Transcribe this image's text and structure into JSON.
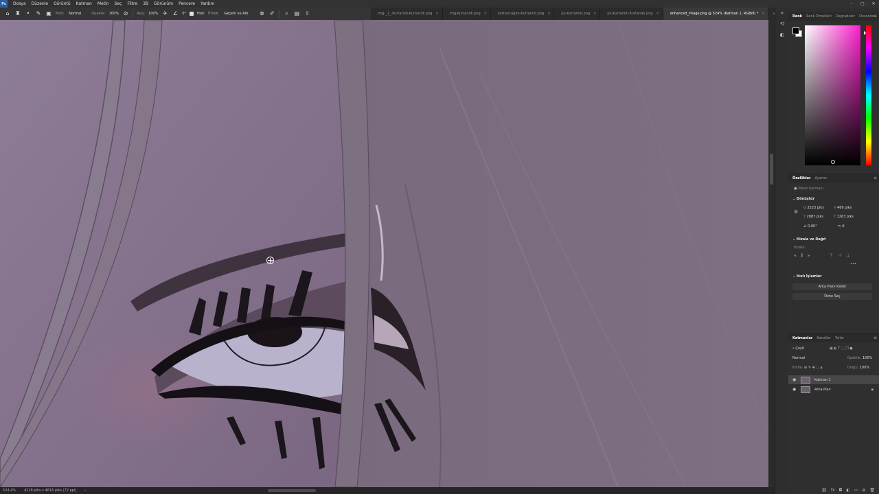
{
  "menubar": {
    "logo": "Ps",
    "items": [
      "Dosya",
      "Düzenle",
      "Görüntü",
      "Katman",
      "Metin",
      "Seç",
      "Filtre",
      "3B",
      "Görünüm",
      "Pencere",
      "Yardım"
    ],
    "window_controls": [
      "–",
      "▢",
      "✕"
    ]
  },
  "options": {
    "mode_label": "Mod:",
    "mode_value": "Normal",
    "opacity_label": "Opaklık:",
    "opacity_value": "100%",
    "flow_label": "Akış:",
    "flow_value": "100%",
    "angle_value": "0°",
    "hizli_label": "Hızlı",
    "sample_label": "Örnek:",
    "sample_value": "Geçerli ve Altı"
  },
  "tabs": [
    {
      "label": "img-_1_-Kurtarıldı-Kurtarıldı.png",
      "active": false
    },
    {
      "label": "img-Kurtarıldı.png",
      "active": false
    },
    {
      "label": "kurtarıcağım-Kurtarıldı.png",
      "active": false
    },
    {
      "label": "px-Kurtarıldı.png",
      "active": false
    },
    {
      "label": "px-Kurtarıldı-Kurtarıldı.png",
      "active": false
    },
    {
      "label": "enhanced_image.png @ 524% (Katman 1, RGB/8) *",
      "active": true
    }
  ],
  "tab_close": "×",
  "tab_overflow": "»",
  "status": {
    "zoom": "524,4%",
    "doc_size": "4128 piks x 4616 piks (72 ppi)",
    "arrow": "›"
  },
  "color_panel": {
    "tabs": [
      "Renk",
      "Renk Örnekleri",
      "Degradeler",
      "Desenler"
    ],
    "active_tab": "Renk",
    "foreground": "#000000",
    "background": "#ffffff",
    "hue_color": "#ff1fcf"
  },
  "properties": {
    "tabs": [
      "Özellikler",
      "Ayarlar"
    ],
    "layer_type": "Piksel Katmanı",
    "transform_title": "Dönüştür",
    "w_label": "G",
    "w_value": "2223 piks",
    "x_label": "X",
    "x_value": "469 piks",
    "h_label": "Y",
    "h_value": "2887 piks",
    "y_label": "Y",
    "y_value": "1263 piks",
    "angle_value": "0,00°",
    "align_title": "Hizala ve Dağıt",
    "align_sub": "Hizala:",
    "quick_title": "Hızlı İşlemler",
    "remove_bg_button": "Arka Planı Kaldır",
    "select_subject_button": "Özne Seç",
    "more": "•••"
  },
  "layers": {
    "tabs": [
      "Katmanlar",
      "Kanallar",
      "Yollar"
    ],
    "filter_label": "Çeşit",
    "blend_mode": "Normal",
    "opacity_label": "Opaklık:",
    "opacity_value": "100%",
    "lock_label": "Kilitle:",
    "fill_label": "Dolgu:",
    "fill_value": "100%",
    "items": [
      {
        "name": "Katman 1",
        "selected": true,
        "locked": false
      },
      {
        "name": "Arka Plan",
        "selected": false,
        "locked": true
      }
    ]
  }
}
